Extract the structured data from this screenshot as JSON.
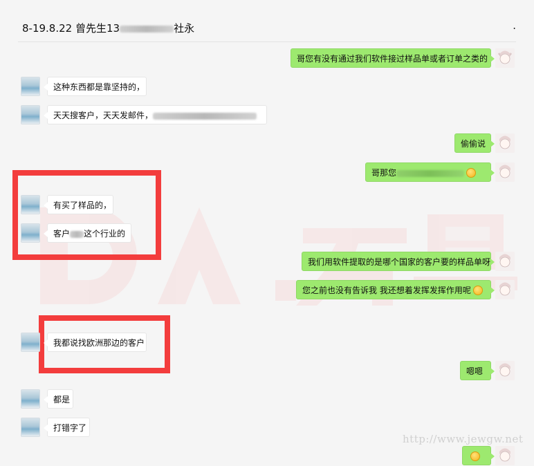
{
  "header": {
    "title": "8-19.8.22 曾先生13",
    "title_tail": "社永",
    "more": "."
  },
  "messages": [
    {
      "text": "哥您有没有通过我们软件接过样品单或者订单之类的"
    },
    {
      "text": "这种东西都是靠坚持的，"
    },
    {
      "text_a": "天天搜客户，天天发邮件，"
    },
    {
      "text": "偷偷说"
    },
    {
      "text_a": "哥那您",
      "text_b": ""
    },
    {
      "text": "有买了样品的，"
    },
    {
      "text_a": "客户",
      "text_b": "这个行业的"
    },
    {
      "text": "我们用软件提取的是哪个国家的客户要的样品单呀"
    },
    {
      "text": "您之前也没有告诉我 我还想着发挥发挥作用呢"
    },
    {
      "text": "我都说找欧洲那边的客户"
    },
    {
      "text": "嗯嗯"
    },
    {
      "text": "都是"
    },
    {
      "text": "打错字了"
    }
  ],
  "watermark": {
    "text": "http://www.jewgw.net"
  },
  "colors": {
    "sent_bubble": "#9de96f",
    "highlight_box": "#f33d3d",
    "background": "#f5f5f5"
  },
  "icons": [
    "sent-avatar",
    "received-avatar",
    "smiley-emoji-icon"
  ]
}
